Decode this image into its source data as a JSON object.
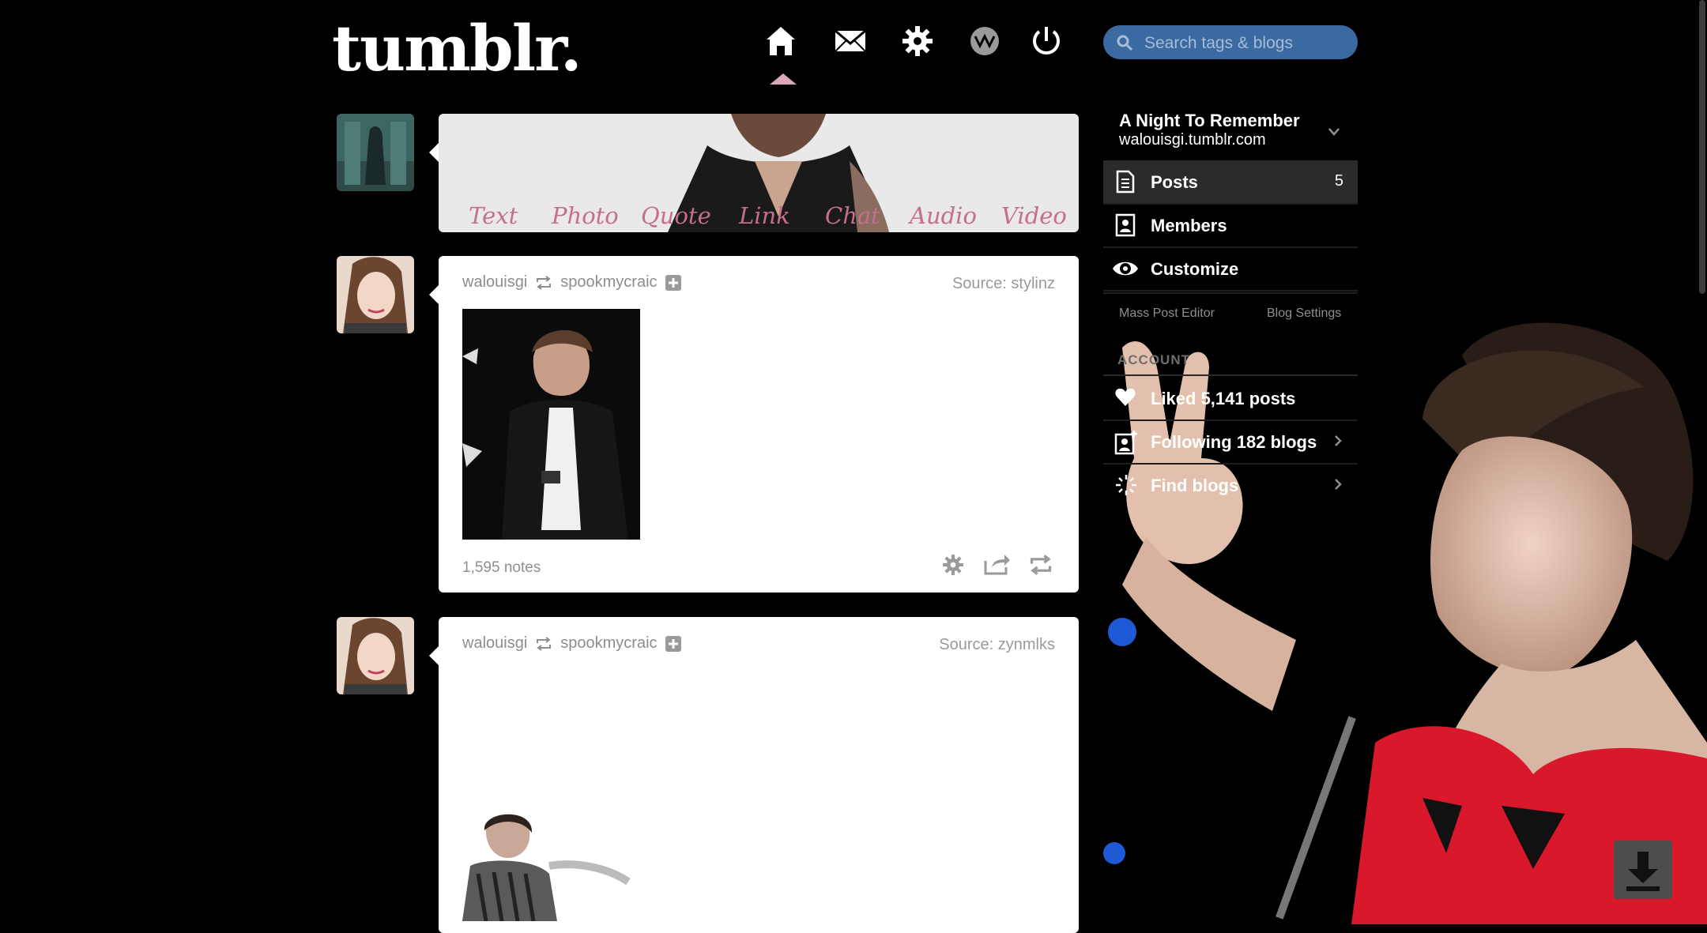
{
  "header": {
    "logo": "tumblr.",
    "search_placeholder": "Search tags & blogs",
    "nav": [
      "home-icon",
      "inbox-icon",
      "settings-icon",
      "activity-icon",
      "logout-icon"
    ]
  },
  "compose": {
    "options": [
      "Text",
      "Photo",
      "Quote",
      "Link",
      "Chat",
      "Audio",
      "Video"
    ]
  },
  "posts": [
    {
      "author": "walouisgi",
      "reblogged_from": "spookmycraic",
      "source": "Source: stylinz",
      "notes": "1,595 notes"
    },
    {
      "author": "walouisgi",
      "reblogged_from": "spookmycraic",
      "source": "Source: zynmlks"
    }
  ],
  "sidebar": {
    "blog_title": "A Night To Remember",
    "blog_url": "walouisgi.tumblr.com",
    "items": [
      {
        "label": "Posts",
        "count": "5"
      },
      {
        "label": "Members"
      },
      {
        "label": "Customize"
      }
    ],
    "mass_post_editor": "Mass Post Editor",
    "blog_settings": "Blog Settings",
    "account_label": "ACCOUNT",
    "account_items": [
      {
        "label": "Liked 5,141 posts"
      },
      {
        "label": "Following 182 blogs"
      },
      {
        "label": "Find blogs"
      }
    ]
  },
  "colors": {
    "search_bg": "#3a6aa1",
    "compose_text": "#c56e8d",
    "active_nav_caret": "#d9a8b9"
  }
}
